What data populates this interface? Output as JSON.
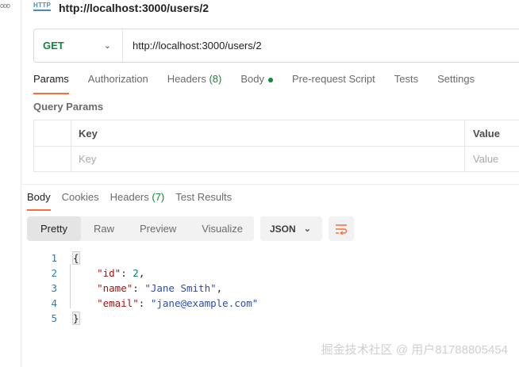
{
  "header": {
    "icon_text": "HTTP",
    "url_title": "http://localhost:3000/users/2"
  },
  "request": {
    "method": "GET",
    "url": "http://localhost:3000/users/2"
  },
  "request_tabs": [
    {
      "label": "Params",
      "active": true
    },
    {
      "label": "Authorization"
    },
    {
      "label": "Headers",
      "count": "(8)"
    },
    {
      "label": "Body",
      "dot": true
    },
    {
      "label": "Pre-request Script"
    },
    {
      "label": "Tests"
    },
    {
      "label": "Settings"
    }
  ],
  "query_params": {
    "title": "Query Params",
    "columns": [
      "Key",
      "Value"
    ],
    "placeholders": {
      "key": "Key",
      "value": "Value"
    }
  },
  "response_tabs": [
    {
      "label": "Body",
      "active": true
    },
    {
      "label": "Cookies"
    },
    {
      "label": "Headers",
      "count": "(7)"
    },
    {
      "label": "Test Results"
    }
  ],
  "view_modes": [
    "Pretty",
    "Raw",
    "Preview",
    "Visualize"
  ],
  "format": "JSON",
  "code": {
    "line_numbers": [
      "1",
      "2",
      "3",
      "4",
      "5"
    ],
    "open_brace": "{",
    "close_brace": "}",
    "id_key": "\"id\"",
    "id_value": "2",
    "name_key": "\"name\"",
    "name_value": "\"Jane Smith\"",
    "email_key": "\"email\"",
    "email_value": "\"jane@example.com\""
  },
  "watermark": "掘金技术社区 @ 用户81788805454",
  "colors": {
    "accent": "#ff6c37",
    "method_green": "#0c8a3a",
    "line_number": "#2f7ab5"
  }
}
